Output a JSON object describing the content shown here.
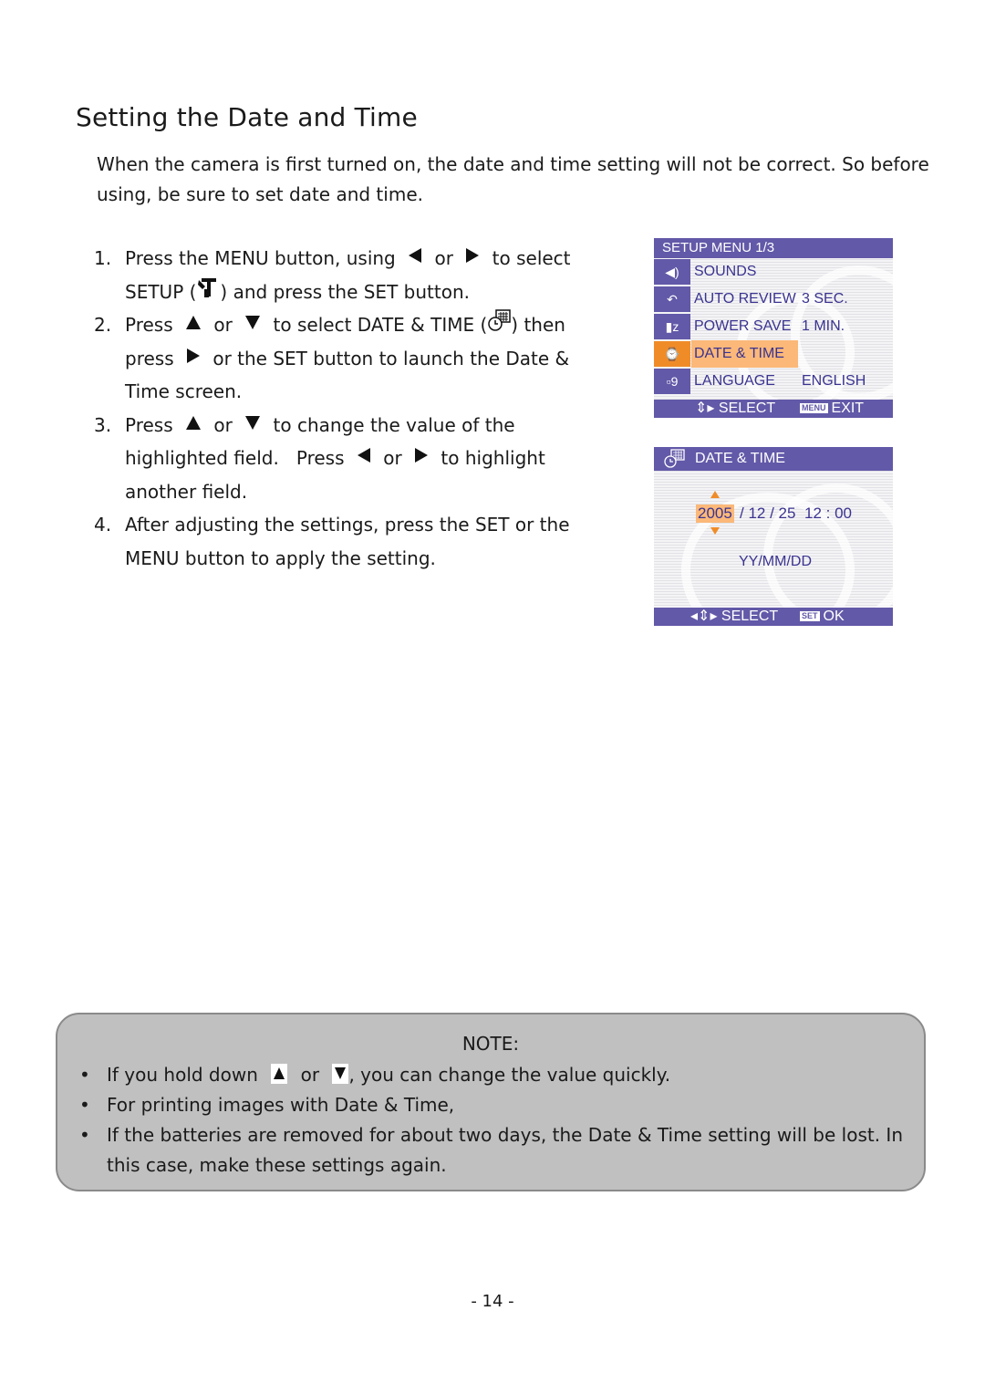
{
  "title": "Setting the Date and Time",
  "intro": "When the camera is first turned on, the date and time setting will not be correct. So before using, be sure to set date and time.",
  "steps": [
    {
      "num": "1.",
      "parts": [
        "Press the ",
        "MENU",
        " button, using ",
        " or ",
        " to select ",
        "SETUP (",
        ") and press the ",
        "SET",
        " button."
      ]
    },
    {
      "num": "2.",
      "parts": [
        "Press ",
        " or ",
        " to select ",
        "DATE & TIME",
        " (",
        ") then press ",
        " or the ",
        "SET",
        " button to launch the Date & Time screen."
      ]
    },
    {
      "num": "3.",
      "parts": [
        "Press ",
        " or ",
        " to change the value of the highlighted field.   Press ",
        " or ",
        " to highlight another field."
      ]
    },
    {
      "num": "4.",
      "parts": [
        "After adjusting the settings, press the ",
        "SET",
        " or the ",
        "MENU",
        " button to apply the setting."
      ]
    }
  ],
  "setup_menu": {
    "header": "SETUP MENU 1/3",
    "items": [
      {
        "icon": "speaker-icon",
        "label": "SOUNDS",
        "value": ""
      },
      {
        "icon": "auto-review-icon",
        "label": "AUTO REVIEW",
        "value": "3 SEC."
      },
      {
        "icon": "power-save-icon",
        "label": "POWER SAVE",
        "value": "1 MIN."
      },
      {
        "icon": "date-time-icon",
        "label": "DATE & TIME",
        "value": "",
        "active": true
      },
      {
        "icon": "language-icon",
        "label": "LANGUAGE",
        "value": "ENGLISH"
      }
    ],
    "footer_select": "SELECT",
    "footer_chip": "MENU",
    "footer_action": "EXIT"
  },
  "date_time_screen": {
    "header": "DATE & TIME",
    "year": "2005",
    "rest": "/ 12 / 25",
    "time": "12 : 00",
    "format": "YY/MM/DD",
    "footer_select": "SELECT",
    "footer_chip": "SET",
    "footer_action": "OK"
  },
  "note": {
    "title": "NOTE:",
    "items": [
      {
        "before": "If you hold down ",
        "mid": " or ",
        "after": ", you can change the value quickly."
      },
      {
        "text": "For printing images with Date & Time,"
      },
      {
        "text": "If the batteries are removed for about two days, the Date & Time setting will be lost. In this case, make these settings again."
      }
    ]
  },
  "page_number": "- 14 -",
  "colors": {
    "lcd_bar": "#6259a8",
    "lcd_highlight": "#fbb879",
    "lcd_active_icon": "#f08c28",
    "note_bg": "#c0c0c0"
  }
}
